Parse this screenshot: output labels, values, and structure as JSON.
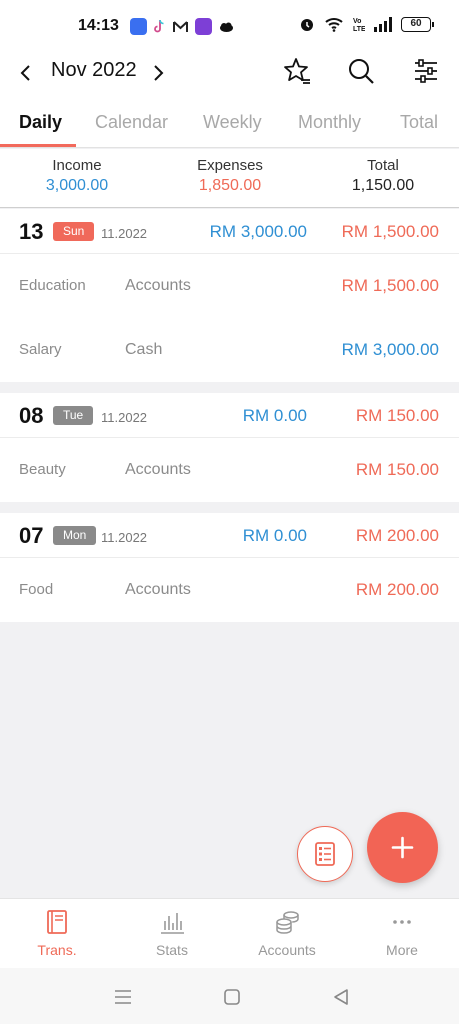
{
  "status_bar": {
    "time": "14:13",
    "battery": "60",
    "notification_icons": [
      "app-icon",
      "tiktok-icon",
      "gmail-icon",
      "game-icon",
      "cloud-icon"
    ]
  },
  "header": {
    "month": "Nov 2022",
    "icons": [
      "chevron-left-icon",
      "chevron-right-icon",
      "star-icon",
      "search-icon",
      "filter-icon"
    ]
  },
  "tabs": [
    {
      "label": "Daily",
      "active": true
    },
    {
      "label": "Calendar",
      "active": false
    },
    {
      "label": "Weekly",
      "active": false
    },
    {
      "label": "Monthly",
      "active": false
    },
    {
      "label": "Total",
      "active": false
    }
  ],
  "summary": {
    "income_label": "Income",
    "income_value": "3,000.00",
    "expenses_label": "Expenses",
    "expenses_value": "1,850.00",
    "total_label": "Total",
    "total_value": "1,150.00"
  },
  "days": [
    {
      "day": "13",
      "weekday": "Sun",
      "month_year": "11.2022",
      "income": "RM 3,000.00",
      "expense": "RM 1,500.00",
      "transactions": [
        {
          "category": "Education",
          "account": "Accounts",
          "amount": "RM 1,500.00",
          "type": "expense"
        },
        {
          "category": "Salary",
          "account": "Cash",
          "amount": "RM 3,000.00",
          "type": "income"
        }
      ]
    },
    {
      "day": "08",
      "weekday": "Tue",
      "month_year": "11.2022",
      "income": "RM 0.00",
      "expense": "RM 150.00",
      "transactions": [
        {
          "category": "Beauty",
          "account": "Accounts",
          "amount": "RM 150.00",
          "type": "expense"
        }
      ]
    },
    {
      "day": "07",
      "weekday": "Mon",
      "month_year": "11.2022",
      "income": "RM 0.00",
      "expense": "RM 200.00",
      "transactions": [
        {
          "category": "Food",
          "account": "Accounts",
          "amount": "RM 200.00",
          "type": "expense"
        }
      ]
    }
  ],
  "bottom_nav": [
    {
      "label": "Trans.",
      "icon": "book-icon",
      "active": true
    },
    {
      "label": "Stats",
      "icon": "bar-chart-icon",
      "active": false
    },
    {
      "label": "Accounts",
      "icon": "coins-icon",
      "active": false
    },
    {
      "label": "More",
      "icon": "more-dots-icon",
      "active": false
    }
  ],
  "colors": {
    "accent": "#f26455",
    "income": "#2f8fd3",
    "expense": "#ef6a57"
  }
}
